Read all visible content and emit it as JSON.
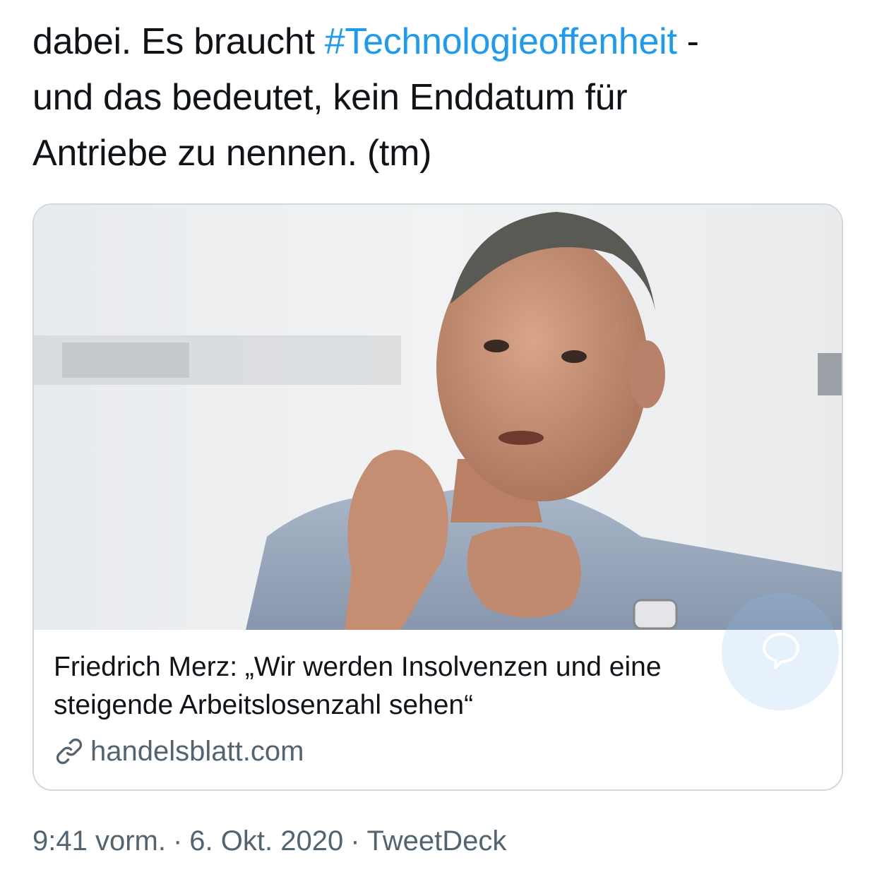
{
  "tweet": {
    "text_line_1_prefix": "dabei. Es braucht ",
    "text_line_1_hashtag": "#Technologieoffenheit",
    "text_line_1_suffix": " -",
    "text_line_2": "und das bedeutet, kein Enddatum für",
    "text_line_3": "Antriebe zu nennen. (tm)"
  },
  "card": {
    "title_line_1": "Friedrich Merz: „Wir werden Insolvenzen und eine",
    "title_line_2": "steigende Arbeitslosenzahl sehen“",
    "source": "handelsblatt.com",
    "image_icon": "photo-of-speaking-man",
    "link_icon": "link-icon"
  },
  "meta": {
    "time": "9:41 vorm.",
    "date": "6. Okt. 2020",
    "client": "TweetDeck",
    "separator": "·"
  },
  "colors": {
    "hashtag": "#1d9bf0",
    "secondary_text": "#536471",
    "border": "#cfd9de"
  }
}
